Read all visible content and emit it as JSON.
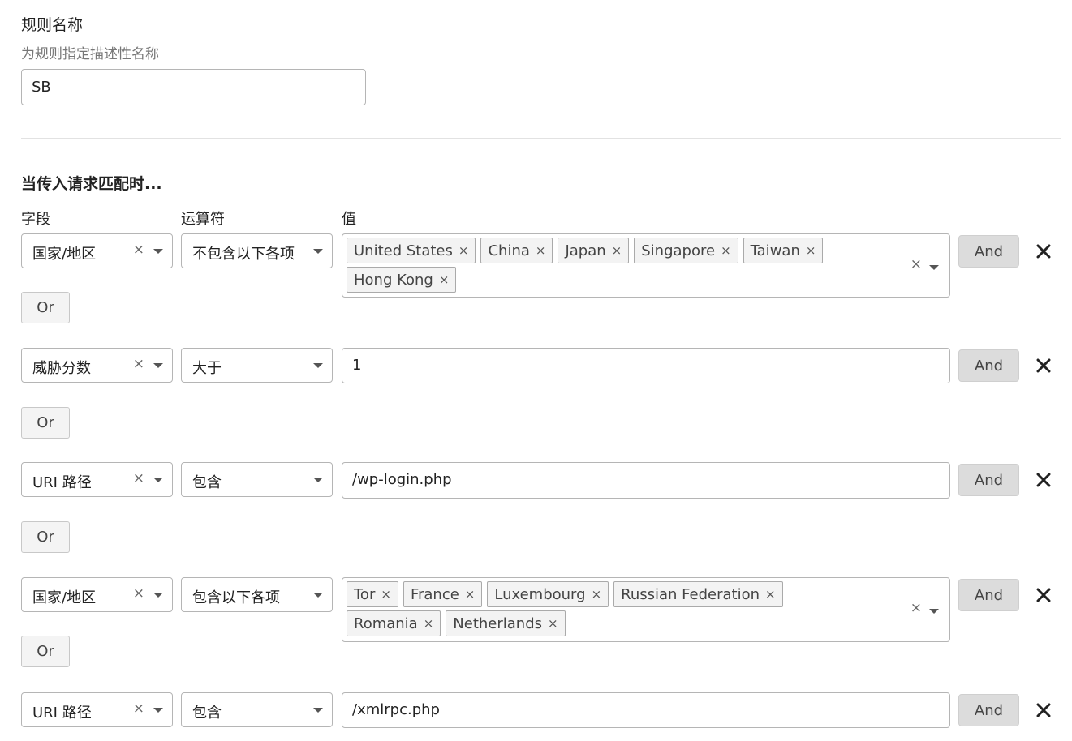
{
  "rule_name": {
    "label": "规则名称",
    "hint": "为规则指定描述性名称",
    "value": "SB"
  },
  "match": {
    "title": "当传入请求匹配时...",
    "columns": {
      "field": "字段",
      "operator": "运算符",
      "value": "值"
    },
    "buttons": {
      "and": "And",
      "or": "Or"
    },
    "icons": {
      "remove": "close-icon",
      "clear": "clear-icon",
      "caret": "chevron-down-icon"
    },
    "conditions": [
      {
        "field": "国家/地区",
        "operator": "不包含以下各项",
        "tags": [
          "United States",
          "China",
          "Japan",
          "Singapore",
          "Taiwan",
          "Hong Kong"
        ],
        "value": ""
      },
      {
        "field": "威胁分数",
        "operator": "大于",
        "tags": [],
        "value": "1"
      },
      {
        "field": "URI 路径",
        "operator": "包含",
        "tags": [],
        "value": "/wp-login.php"
      },
      {
        "field": "国家/地区",
        "operator": "包含以下各项",
        "tags": [
          "Tor",
          "France",
          "Luxembourg",
          "Russian Federation",
          "Romania",
          "Netherlands"
        ],
        "value": ""
      },
      {
        "field": "URI 路径",
        "operator": "包含",
        "tags": [],
        "value": "/xmlrpc.php"
      }
    ]
  },
  "colors": {
    "tag_bg": "#f3f3f3",
    "and_bg": "#dcdcdc",
    "or_bg": "#f4f4f4",
    "border": "#b5b5b5"
  }
}
